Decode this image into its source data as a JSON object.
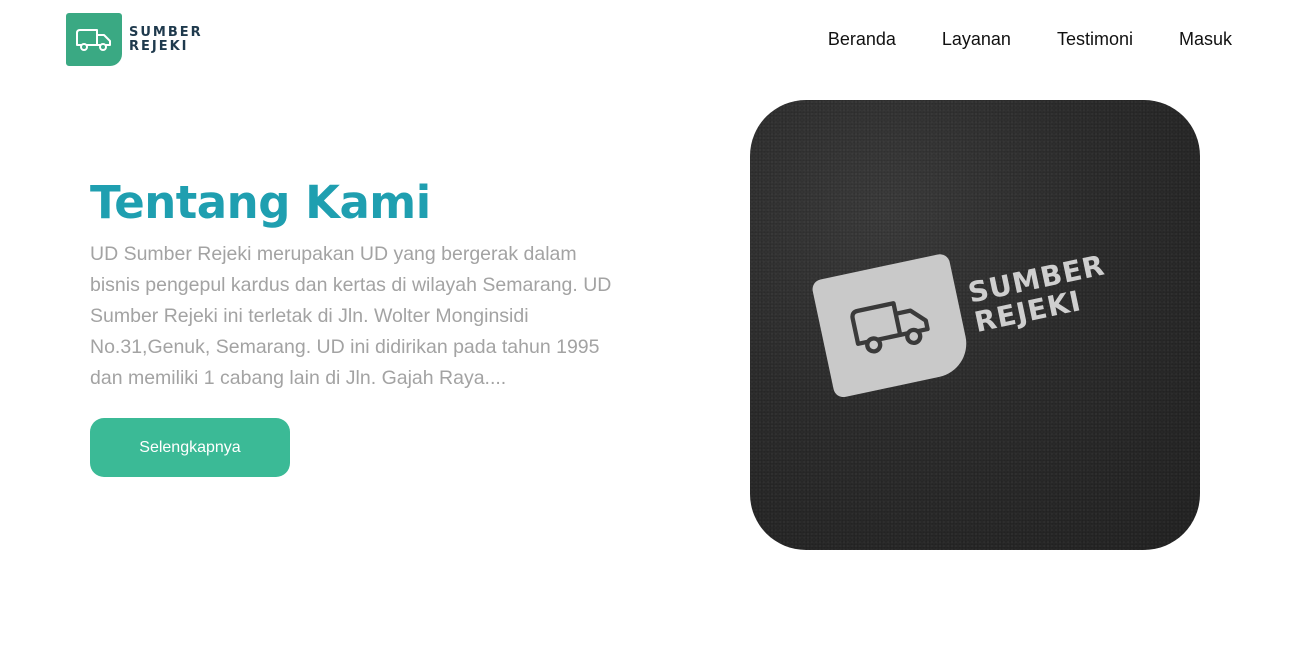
{
  "brand": {
    "line1": "SUMBER",
    "line2": "REJEKI",
    "logo_icon": "truck-icon",
    "accent": "#3aa983"
  },
  "nav": {
    "items": [
      "Beranda",
      "Layanan",
      "Testimoni",
      "Masuk"
    ]
  },
  "about": {
    "title": "Tentang Kami",
    "body": "UD Sumber Rejeki merupakan UD yang bergerak dalam bisnis pengepul kardus dan kertas di wilayah Semarang. UD Sumber Rejeki ini terletak di Jln. Wolter Monginsidi No.31,Genuk, Semarang. UD ini didirikan pada tahun 1995 dan memiliki 1 cabang lain di Jln. Gajah Raya....",
    "button": "Selengkapnya",
    "title_color": "#1f9fb0",
    "button_color": "#3bba96"
  },
  "hero_image": {
    "line1": "SUMBER",
    "line2": "REJEKI",
    "icon": "truck-icon"
  }
}
